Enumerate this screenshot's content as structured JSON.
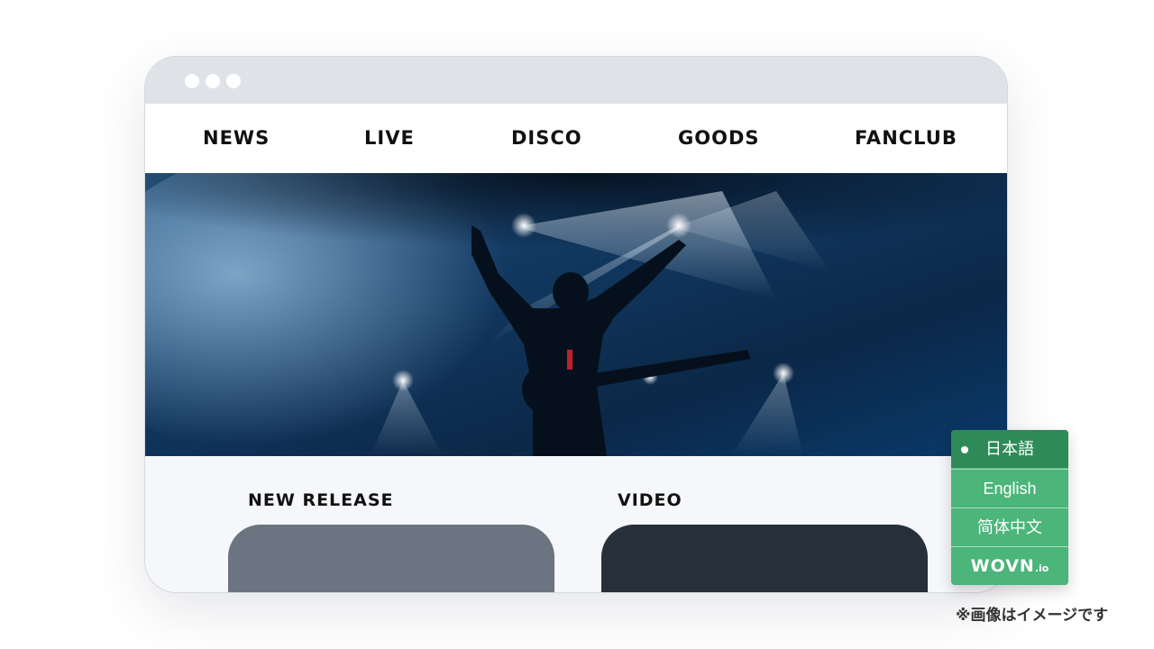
{
  "browser": {
    "window_dots": [
      "window-dot",
      "window-dot",
      "window-dot"
    ]
  },
  "nav": {
    "items": [
      {
        "label": "NEWS"
      },
      {
        "label": "LIVE"
      },
      {
        "label": "DISCO"
      },
      {
        "label": "GOODS"
      },
      {
        "label": "FANCLUB"
      }
    ]
  },
  "hero": {
    "image": "concert-stage-photo",
    "colors": {
      "dark": "#061426",
      "mid": "#0f3558",
      "light": "#b9d6ee"
    }
  },
  "sections": {
    "new_release": {
      "title": "NEW RELEASE",
      "card_color": "#6b7480"
    },
    "video": {
      "title": "VIDEO",
      "card_color": "#27303a"
    }
  },
  "language_switcher": {
    "options": [
      {
        "label": "日本語",
        "selected": true
      },
      {
        "label": "English",
        "selected": false
      },
      {
        "label": "简体中文",
        "selected": false
      }
    ],
    "brand": {
      "name": "WOVN",
      "suffix": ".io"
    },
    "colors": {
      "base": "#4bb57a",
      "active": "#2e8b58"
    }
  },
  "footnote": "※画像はイメージです"
}
